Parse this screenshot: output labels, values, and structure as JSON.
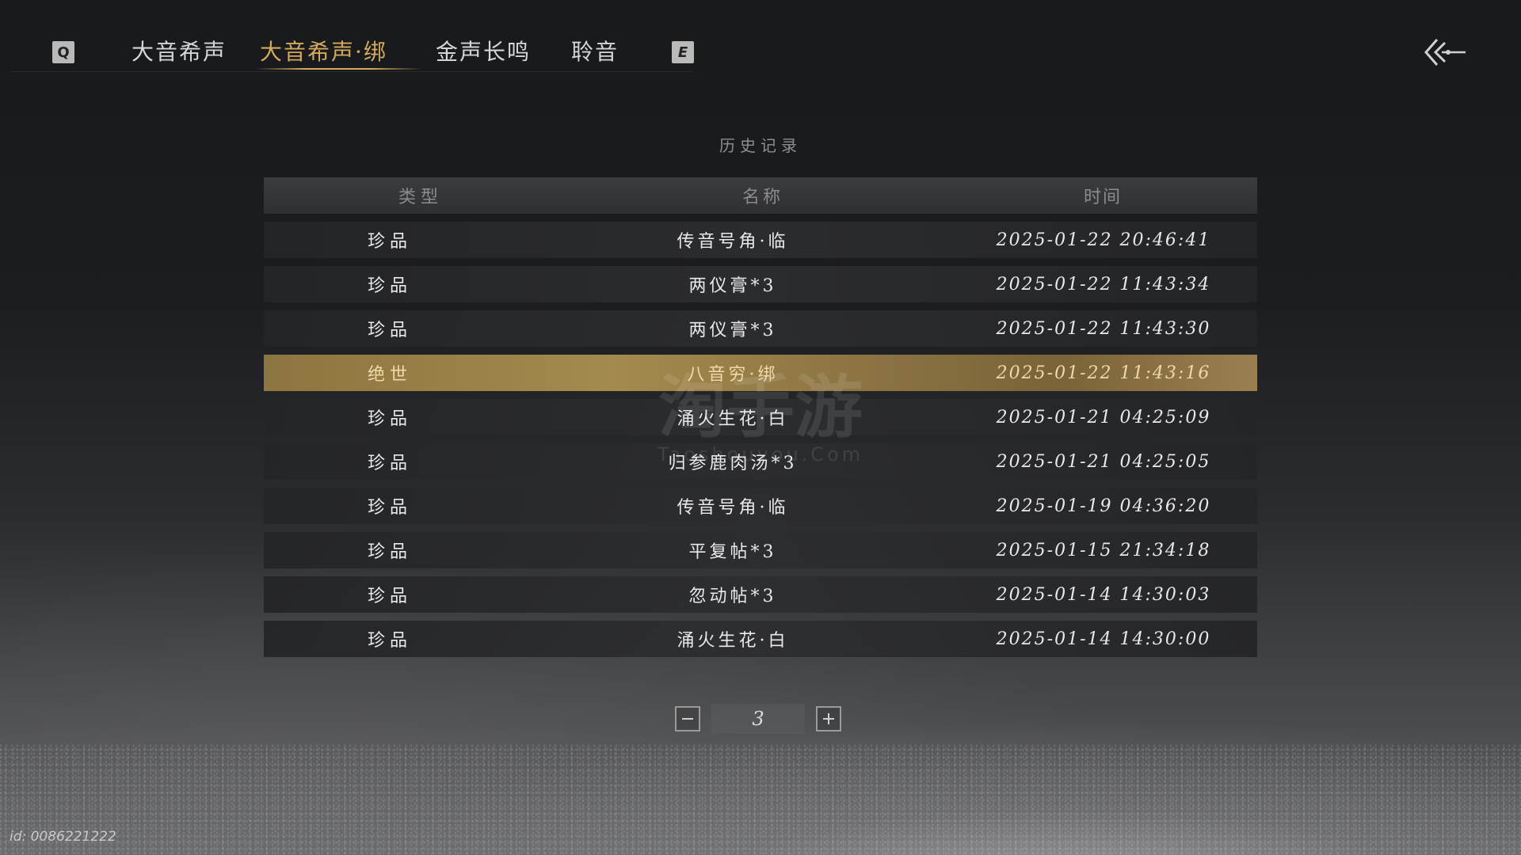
{
  "nav": {
    "left_key": "Q",
    "right_key": "E",
    "tabs": [
      {
        "label": "大音希声"
      },
      {
        "label": "大音希声·绑"
      },
      {
        "label": "金声长鸣"
      },
      {
        "label": "聆音"
      }
    ],
    "active_tab": 1
  },
  "section_title": "历史记录",
  "table": {
    "headers": {
      "type": "类型",
      "name": "名称",
      "time": "时间"
    },
    "rows": [
      {
        "type": "珍品",
        "name": "传音号角·临",
        "time": "2025-01-22 20:46:41"
      },
      {
        "type": "珍品",
        "name": "两仪膏*3",
        "time": "2025-01-22 11:43:34"
      },
      {
        "type": "珍品",
        "name": "两仪膏*3",
        "time": "2025-01-22 11:43:30"
      },
      {
        "type": "绝世",
        "name": "八音穷·绑",
        "time": "2025-01-22 11:43:16",
        "highlight": true
      },
      {
        "type": "珍品",
        "name": "涌火生花·白",
        "time": "2025-01-21 04:25:09"
      },
      {
        "type": "珍品",
        "name": "归参鹿肉汤*3",
        "time": "2025-01-21 04:25:05"
      },
      {
        "type": "珍品",
        "name": "传音号角·临",
        "time": "2025-01-19 04:36:20"
      },
      {
        "type": "珍品",
        "name": "平复帖*3",
        "time": "2025-01-15 21:34:18"
      },
      {
        "type": "珍品",
        "name": "忽动帖*3",
        "time": "2025-01-14 14:30:03"
      },
      {
        "type": "珍品",
        "name": "涌火生花·白",
        "time": "2025-01-14 14:30:00"
      }
    ]
  },
  "pager": {
    "page": "3"
  },
  "watermark": {
    "main": "淘手游",
    "sub": "Taoshouyou.Com"
  },
  "user_id": "id: 0086221222",
  "colors": {
    "accent_gold": "#d4a95e",
    "highlight_row": "#a38a4d"
  }
}
